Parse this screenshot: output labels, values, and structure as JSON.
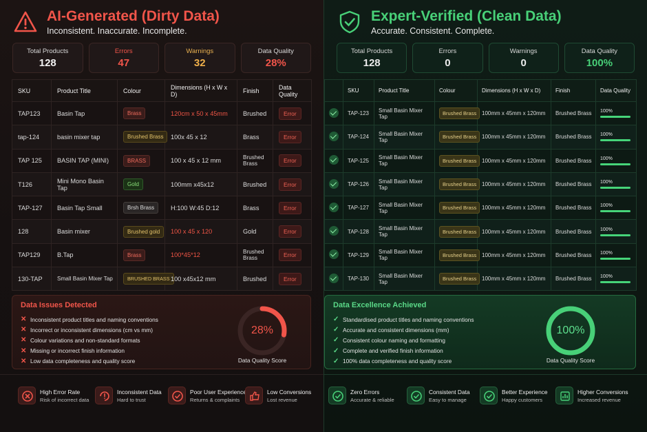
{
  "dirty": {
    "title": "AI-Generated (Dirty Data)",
    "subtitle": "Inconsistent. Inaccurate. Incomplete.",
    "stats": [
      {
        "label": "Total Products",
        "value": "128"
      },
      {
        "label": "Errors",
        "value": "47"
      },
      {
        "label": "Warnings",
        "value": "32"
      },
      {
        "label": "Data Quality",
        "value": "28%"
      }
    ],
    "columns": [
      "SKU",
      "Product Title",
      "Colour",
      "Dimensions (H x W x D)",
      "Finish",
      "Data Quality"
    ],
    "rows": [
      {
        "sku": "TAP123",
        "title": "Basin Tap",
        "colour": "Brass",
        "dims": "120cm x 50 x 45mm",
        "finish": "Brushed",
        "dq": "Error"
      },
      {
        "sku": "tap-124",
        "title": "basin mixer tap",
        "colour": "Brushed Brass",
        "dims": "100x 45 x 12",
        "finish": "Brass",
        "dq": "Error"
      },
      {
        "sku": "TAP 125",
        "title": "BASIN TAP (MINI)",
        "colour": "BRASS",
        "dims": "100 x 45 x 12 mm",
        "finish": "Brushed Brass",
        "dq": "Error"
      },
      {
        "sku": "T126",
        "title": "Mini Mono Basin Tap",
        "colour": "Gold",
        "dims": "100mm x45x12",
        "finish": "Brushed",
        "dq": "Error"
      },
      {
        "sku": "TAP-127",
        "title": "Basin Tap Small",
        "colour": "Brsh Brass",
        "dims": "H:100 W:45 D:12",
        "finish": "Brass",
        "dq": "Error"
      },
      {
        "sku": "128",
        "title": "Basin mixer",
        "colour": "Brushed gold",
        "dims": "100 x 45 x 120",
        "finish": "Gold",
        "dq": "Error"
      },
      {
        "sku": "TAP129",
        "title": "B.Tap",
        "colour": "Brass",
        "dims": "100*45*12",
        "finish": "Brushed Brass",
        "dq": "Error"
      },
      {
        "sku": "130-TAP",
        "title": "Small Basin Mixer Tap",
        "colour": "BRUSHED BRASS",
        "dims": "100 x45x12 mm",
        "finish": "Brushed",
        "dq": "Error"
      }
    ],
    "issues_title": "Data Issues Detected",
    "issues": [
      "Inconsistent product titles and naming conventions",
      "Incorrect or inconsistent dimensions (cm vs mm)",
      "Colour variations and non-standard formats",
      "Missing or incorrect finish information",
      "Low data completeness and quality score"
    ],
    "gauge_value": "28%",
    "gauge_fraction": 0.28,
    "gauge_label": "Data Quality Score",
    "footer": [
      {
        "title": "High Error Rate",
        "sub": "Risk of incorrect data",
        "icon": "x-circle-icon"
      },
      {
        "title": "Inconsistent Data",
        "sub": "Hard to trust",
        "icon": "refresh-alert-icon"
      },
      {
        "title": "Poor User Experience",
        "sub": "Returns & complaints",
        "icon": "check-circle-icon"
      },
      {
        "title": "Low Conversions",
        "sub": "Lost revenue",
        "icon": "thumbs-down-icon"
      }
    ]
  },
  "clean": {
    "title": "Expert-Verified (Clean Data)",
    "subtitle": "Accurate. Consistent. Complete.",
    "stats": [
      {
        "label": "Total Products",
        "value": "128"
      },
      {
        "label": "Errors",
        "value": "0"
      },
      {
        "label": "Warnings",
        "value": "0"
      },
      {
        "label": "Data Quality",
        "value": "100%"
      }
    ],
    "columns": [
      "SKU",
      "Product Title",
      "Colour",
      "Dimensions (H x W x D)",
      "Finish",
      "Data Quality"
    ],
    "rows": [
      {
        "sku": "TAP-123",
        "title": "Small Basin Mixer Tap",
        "colour": "Brushed Brass",
        "dims": "100mm x 45mm x 120mm",
        "finish": "Brushed Brass",
        "dq": "100%",
        "fraction": 1.0
      },
      {
        "sku": "TAP-124",
        "title": "Small Basin Mixer Tap",
        "colour": "Brushed Brass",
        "dims": "100mm x 45mm x 120mm",
        "finish": "Brushed Brass",
        "dq": "100%",
        "fraction": 1.0
      },
      {
        "sku": "TAP-125",
        "title": "Small Basin Mixer Tap",
        "colour": "Brushed Brass",
        "dims": "100mm x 45mm x 120mm",
        "finish": "Brushed Brass",
        "dq": "100%",
        "fraction": 1.0
      },
      {
        "sku": "TAP-126",
        "title": "Small Basin Mixer Tap",
        "colour": "Brushed Brass",
        "dims": "100mm x 45mm x 120mm",
        "finish": "Brushed Brass",
        "dq": "100%",
        "fraction": 1.0
      },
      {
        "sku": "TAP-127",
        "title": "Small Basin Mixer Tap",
        "colour": "Brushed Brass",
        "dims": "100mm x 45mm x 120mm",
        "finish": "Brushed Brass",
        "dq": "100%",
        "fraction": 1.0
      },
      {
        "sku": "TAP-128",
        "title": "Small Basin Mixer Tap",
        "colour": "Brushed Brass",
        "dims": "100mm x 45mm x 120mm",
        "finish": "Brushed Brass",
        "dq": "100%",
        "fraction": 1.0
      },
      {
        "sku": "TAP-129",
        "title": "Small Basin Mixer Tap",
        "colour": "Brushed Brass",
        "dims": "100mm x 45mm x 120mm",
        "finish": "Brushed Brass",
        "dq": "100%",
        "fraction": 1.0
      },
      {
        "sku": "TAP-130",
        "title": "Small Basin Mixer Tap",
        "colour": "Brushed Brass",
        "dims": "100mm x 45mm x 120mm",
        "finish": "Brushed Brass",
        "dq": "100%",
        "fraction": 1.0
      }
    ],
    "issues_title": "Data Excellence Achieved",
    "issues": [
      "Standardised product titles and naming conventions",
      "Accurate and consistent dimensions (mm)",
      "Consistent colour naming and formatting",
      "Complete and verified finish information",
      "100% data completeness and quality score"
    ],
    "gauge_value": "100%",
    "gauge_fraction": 1.0,
    "gauge_label": "Data Quality Score",
    "footer": [
      {
        "title": "Zero Errors",
        "sub": "Accurate & reliable",
        "icon": "check-circle-icon"
      },
      {
        "title": "Consistent Data",
        "sub": "Easy to manage",
        "icon": "check-circle-icon"
      },
      {
        "title": "Better Experience",
        "sub": "Happy customers",
        "icon": "check-circle-icon"
      },
      {
        "title": "Higher Conversions",
        "sub": "Increased revenue",
        "icon": "chart-up-icon"
      }
    ]
  },
  "colors": {
    "error": "#f1554a",
    "warning": "#f0b04a",
    "success": "#48d078"
  }
}
